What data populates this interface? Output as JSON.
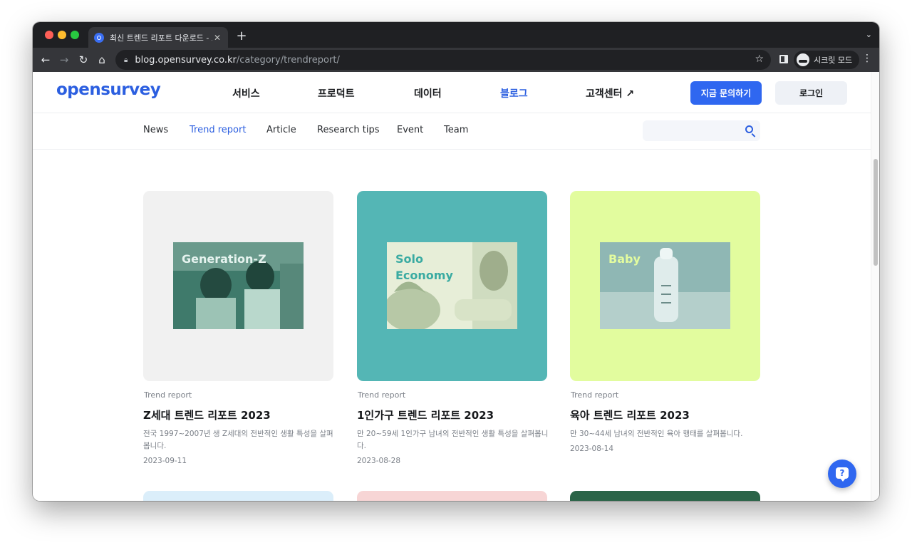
{
  "browser": {
    "tab_title": "최신 트렌드 리포트 다운로드 - 오픈서베이",
    "url_host": "blog.opensurvey.co.kr",
    "url_path": "/category/trendreport/",
    "incognito_label": "시크릿 모드"
  },
  "site": {
    "logo": "opensurvey",
    "menu": [
      {
        "label": "서비스",
        "active": false
      },
      {
        "label": "프로덕트",
        "active": false
      },
      {
        "label": "데이터",
        "active": false
      },
      {
        "label": "블로그",
        "active": true
      },
      {
        "label": "고객센터 ↗",
        "active": false
      }
    ],
    "contact_button": "지금 문의하기",
    "login_button": "로그인"
  },
  "subnav": {
    "items": [
      {
        "label": "News",
        "active": false
      },
      {
        "label": "Trend report",
        "active": true
      },
      {
        "label": "Article",
        "active": false
      },
      {
        "label": "Research tips",
        "active": false
      },
      {
        "label": "Event",
        "active": false
      },
      {
        "label": "Team",
        "active": false
      }
    ],
    "search_placeholder": ""
  },
  "cards": [
    {
      "category": "Trend report",
      "title": "Z세대 트렌드 리포트 2023",
      "desc": "전국 1997~2007년 생 Z세대의 전반적인 생활 특성을 살펴봅니다.",
      "date": "2023-09-11",
      "thumb_label": "Generation-Z",
      "bg_color": "#f1f1f1",
      "label_color": "#e6f3ef"
    },
    {
      "category": "Trend report",
      "title": "1인가구 트렌드 리포트 2023",
      "desc": "만 20~59세 1인가구 남녀의 전반적인 생활 특성을 살펴봅니다.",
      "date": "2023-08-28",
      "thumb_label": "Solo Economy",
      "bg_color": "#54b6b5",
      "label_color": "#3aaba2"
    },
    {
      "category": "Trend report",
      "title": "육아 트렌드 리포트 2023",
      "desc": "만 30~44세 남녀의 전반적인 육아 행태를 살펴봅니다.",
      "date": "2023-08-14",
      "thumb_label": "Baby",
      "bg_color": "#e2fc9e",
      "label_color": "#e3fc9f"
    }
  ],
  "next_row_colors": [
    "#dbeefa",
    "#f7d5d5",
    "#2b6448"
  ]
}
